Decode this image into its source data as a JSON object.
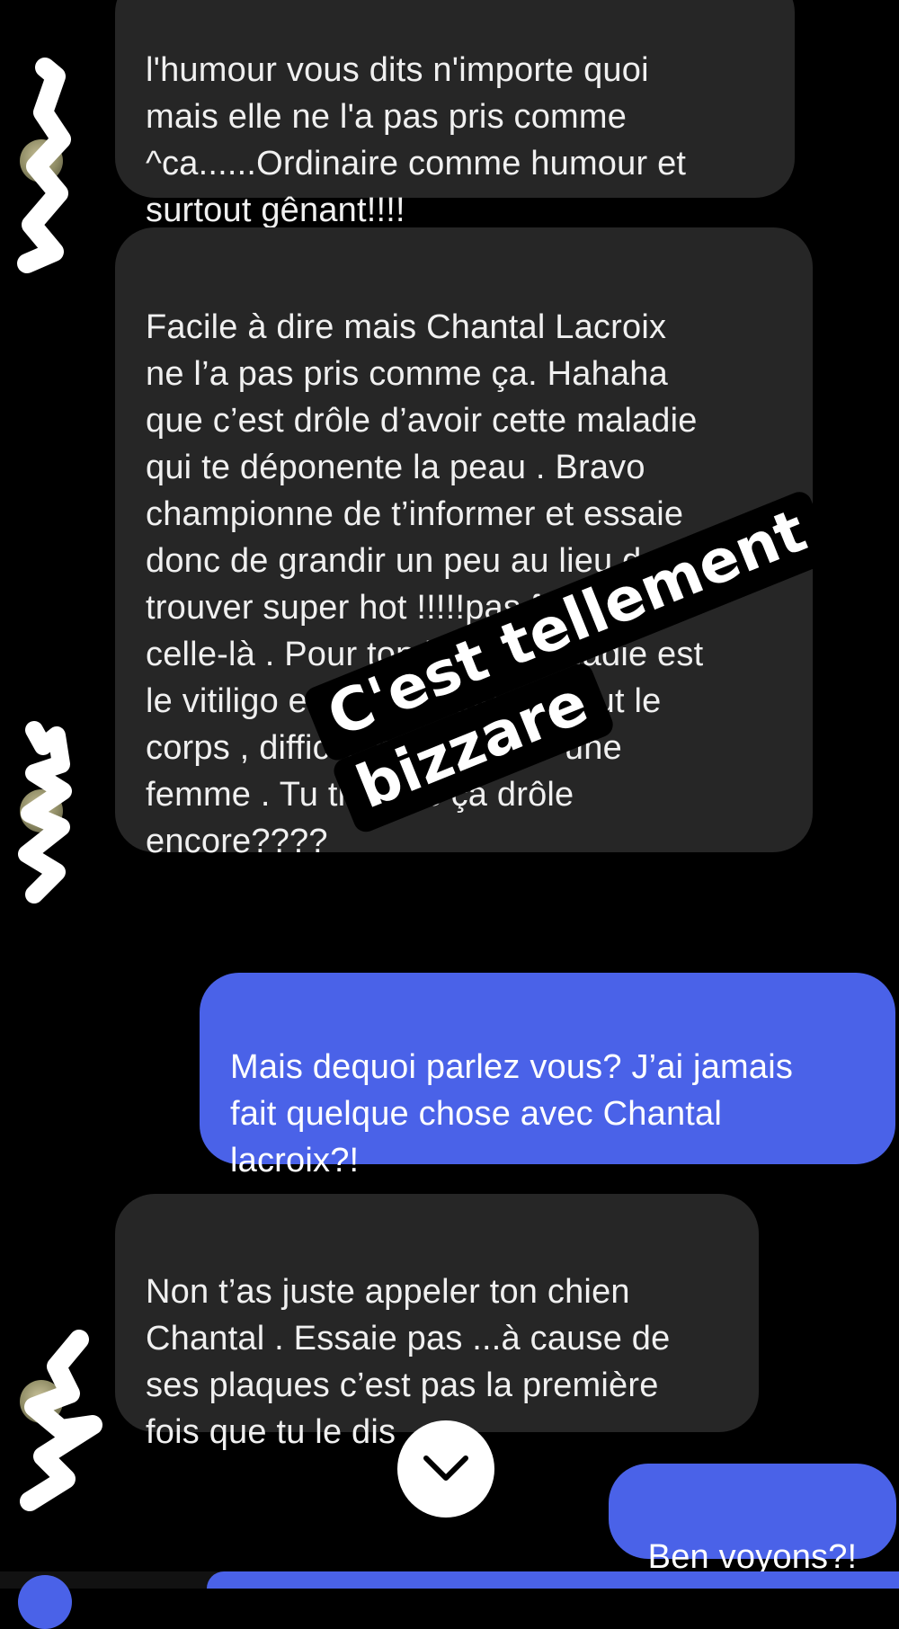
{
  "messages": [
    {
      "sender": "contact",
      "text": "l'humour vous dits n'importe quoi\nmais elle ne l'a pas pris comme\n^ca......Ordinaire comme humour et\nsurtout gênant!!!!"
    },
    {
      "sender": "contact",
      "text": "Facile à dire mais Chantal Lacroix\nne l’a pas pris comme ça.  Hahaha\nque c’est drôle d’avoir cette maladie\nqui te déponente la peau . Bravo\nchampionne de t’informer et essaie\ndonc de grandir un peu au lieu de te\ntrouver super hot !!!!!pas forte\ncelle-là . Pour ton info la maladie est\nle vitiligo et se propage sur tout le\ncorps , difficile à vivre pour une\nfemme . Tu trouves ça drôle\nencore????"
    },
    {
      "sender": "me",
      "text": "Mais dequoi parlez vous? J’ai jamais\nfait quelque chose avec Chantal\nlacroix?!"
    },
    {
      "sender": "contact",
      "text": "Non t’as juste appeler ton chien\nChantal . Essaie pas ...à cause de\nses plaques c’est pas la première\nfois que tu le dis"
    },
    {
      "sender": "me",
      "text": "Ben voyons?!"
    }
  ],
  "sticker": {
    "line1": "C'est tellement",
    "line2": "bizzare"
  },
  "icons": {
    "scroll_down": "chevron-down-icon"
  },
  "colors": {
    "background": "#000000",
    "incoming_bubble": "#262626",
    "outgoing_bubble": "#4a62e8",
    "scribble": "#ffffff"
  }
}
